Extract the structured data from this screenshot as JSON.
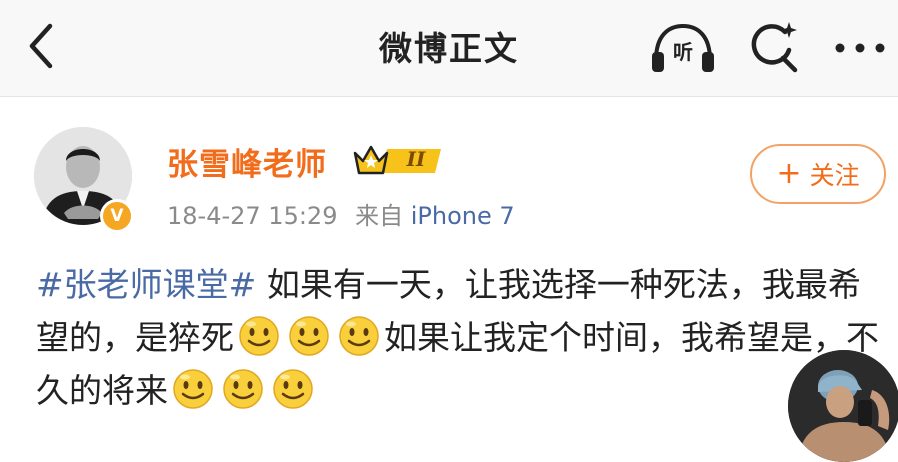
{
  "header": {
    "title": "微博正文",
    "listen_label": "听",
    "icons": {
      "back": "chevron-left-icon",
      "listen": "headphones-icon",
      "search": "search-sparkle-icon",
      "more": "more-horizontal-icon"
    }
  },
  "post": {
    "author": {
      "name": "张雪峰老师",
      "verified_badge": "V",
      "member_level": "II",
      "accent_color": "#f26d1b"
    },
    "timestamp": "18-4-27 15:29",
    "source_prefix": "来自",
    "source": "iPhone 7",
    "follow": {
      "plus": "+",
      "label": "关注"
    },
    "content": {
      "hashtag": "#张老师课堂#",
      "text_1": "如果有一天，让我选择一种死法，我最希望的，是猝死",
      "text_2": "如果让我定个时间，我希望是，不久的将来",
      "emoji_name": "smile-emoji-icon"
    }
  },
  "colors": {
    "link": "#4a6aa6",
    "username": "#f26d1b",
    "meta": "#8a8a8a",
    "follow_border": "#f2a265",
    "topbar": "#f8f8f8"
  }
}
